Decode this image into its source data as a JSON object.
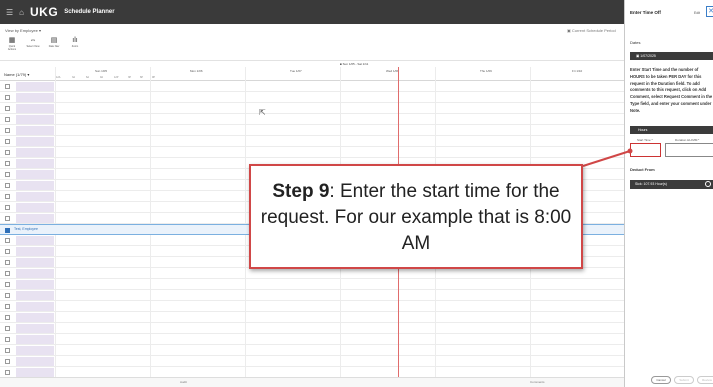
{
  "topbar": {
    "logo": "UKG",
    "app_title": "Schedule Planner",
    "menu_icon": "menu-icon",
    "home_icon": "home-icon"
  },
  "view": {
    "label": "View by Employee ▾",
    "top_right": "Current Schedule Period"
  },
  "toolbar": [
    {
      "icon": "quick-actions-icon",
      "label": "Quick Actions"
    },
    {
      "icon": "select-view-icon",
      "label": "Select View"
    },
    {
      "icon": "date-view-icon",
      "label": "Date Nav"
    },
    {
      "icon": "zoom-icon",
      "label": "Zoom"
    }
  ],
  "date_banner": "■ Sun 1/05 - Sat 1/11",
  "grid": {
    "name_header": "Name (1/79) ▾",
    "days": [
      "Sun 1/05",
      "Mon 1/06",
      "Tue 1/07",
      "Wed 1/08",
      "Thu 1/09",
      "Fri 1/10"
    ],
    "hours": [
      "12A",
      "3A",
      "6A",
      "9A",
      "12P",
      "3P",
      "6P",
      "9P"
    ],
    "selected_employee": "Test, Employee"
  },
  "footer": {
    "left": "Audit",
    "right": "Comments"
  },
  "panel": {
    "title": "Enter Time Off",
    "sub": "Edit",
    "close": "✕",
    "dates_label": "Dates",
    "date_value": "1/07/2025",
    "instructions": "Enter Start Time and the number of HOURS to be taken PER DAY for this request in the Duration field. To add comments to this request, click on Add Comment, select Request Comment in the Type field, and enter your comment under Note.",
    "hours_label": "Hours",
    "start_time_label": "Start Time *",
    "duration_label": "Duration HH:MM *",
    "deduct_label": "Deduct From",
    "bank": "Sick: 107.93 Hour(s)",
    "buttons": [
      "Cancel",
      "Submit",
      "Review"
    ]
  },
  "callout": {
    "step": "Step 9",
    "text": ": Enter the start time for the request. For our example that is 8:00 AM"
  },
  "colors": {
    "callout_border": "#d04747",
    "now_line": "#e06c6c",
    "panel_bar": "#3b3b3b",
    "accent": "#3b7ec8"
  }
}
